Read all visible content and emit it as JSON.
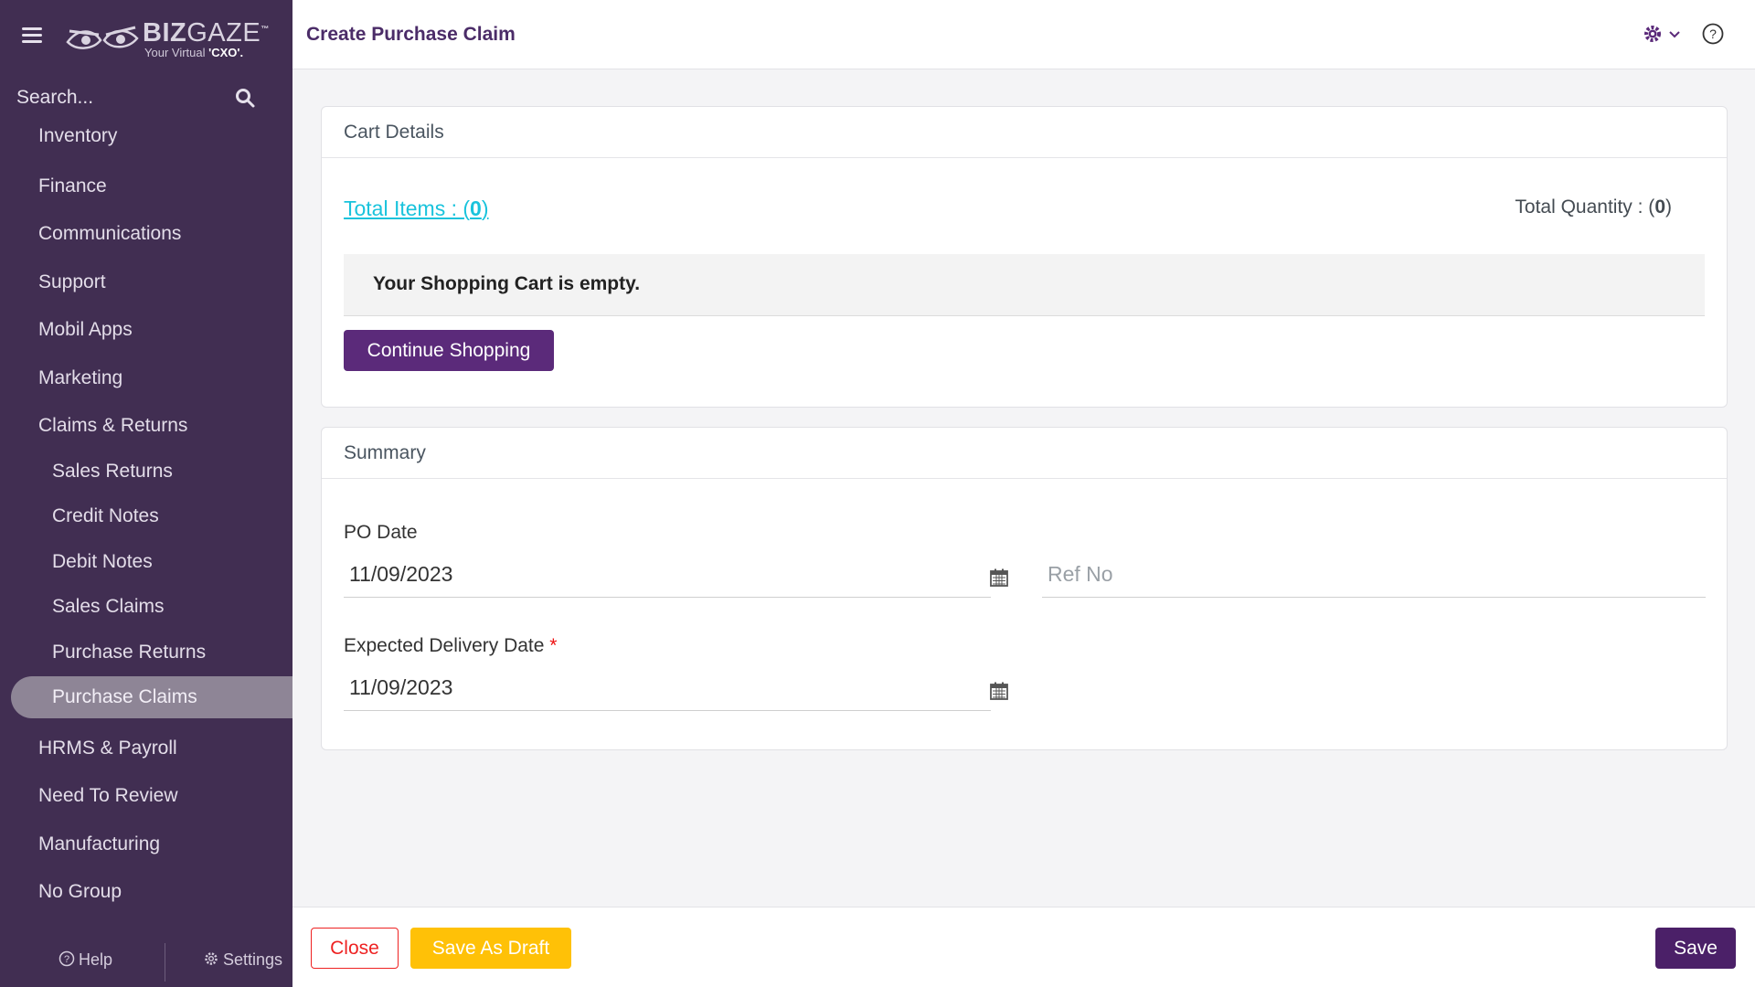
{
  "brand": {
    "name_bold": "BIZ",
    "name_thin": "GAZE",
    "trademark": "™",
    "tagline_prefix": "Your Virtual ",
    "tagline_bold": "'CXO'."
  },
  "search": {
    "placeholder": "Search..."
  },
  "sidebar": {
    "items": [
      {
        "label": "Inventory"
      },
      {
        "label": "Finance"
      },
      {
        "label": "Communications"
      },
      {
        "label": "Support"
      },
      {
        "label": "Mobil Apps"
      },
      {
        "label": "Marketing"
      },
      {
        "label": "Claims & Returns"
      },
      {
        "label": "Sales Returns"
      },
      {
        "label": "Credit Notes"
      },
      {
        "label": "Debit Notes"
      },
      {
        "label": "Sales Claims"
      },
      {
        "label": "Purchase Returns"
      },
      {
        "label": "Purchase Claims"
      },
      {
        "label": "HRMS & Payroll"
      },
      {
        "label": "Need To Review"
      },
      {
        "label": "Manufacturing"
      },
      {
        "label": "No Group"
      }
    ],
    "active": "Purchase Claims",
    "footer": {
      "help": "Help",
      "settings": "Settings"
    }
  },
  "header": {
    "title": "Create Purchase Claim"
  },
  "cart": {
    "title": "Cart Details",
    "total_items_label": "Total Items : (",
    "total_items_value": "0",
    "total_items_suffix": ")",
    "total_qty_label": "Total Quantity : (",
    "total_qty_value": "0",
    "total_qty_suffix": ")",
    "empty_message": "Your Shopping Cart is empty.",
    "continue_label": "Continue Shopping"
  },
  "summary": {
    "title": "Summary",
    "po_date_label": "PO Date",
    "po_date_value": "11/09/2023",
    "ref_no_placeholder": "Ref No",
    "delivery_label": "Expected Delivery Date",
    "required_mark": "*",
    "delivery_value": "11/09/2023"
  },
  "footer": {
    "close_label": "Close",
    "draft_label": "Save As Draft",
    "save_label": "Save"
  },
  "colors": {
    "sidebar": "#412e52",
    "primary": "#5b2a7a",
    "link": "#19c3dc",
    "warning": "#ffc107",
    "danger": "#e22222"
  }
}
